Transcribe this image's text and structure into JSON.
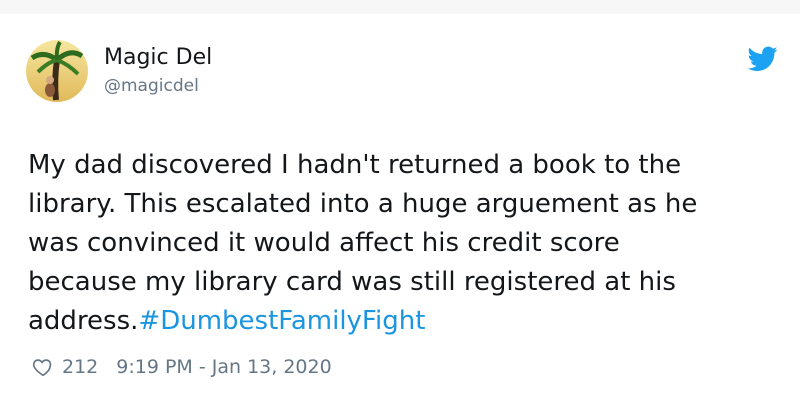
{
  "user": {
    "display_name": "Magic Del",
    "handle": "@magicdel"
  },
  "icons": {
    "avatar": "palm-tree-avatar",
    "brand": "twitter-bird-icon",
    "like": "heart-outline-icon"
  },
  "tweet": {
    "text": "My dad discovered I hadn't returned a book to the\nlibrary. This escalated into a huge arguement as he\nwas convinced it would affect his credit score\nbecause my library card was still registered at his\naddress.",
    "hashtag": "#DumbestFamilyFight"
  },
  "footer": {
    "likes": "212",
    "timestamp": "9:19 PM - Jan 13, 2020"
  },
  "colors": {
    "hashtag": "#1b95e0",
    "brand": "#1da1f2",
    "meta": "#657786"
  }
}
